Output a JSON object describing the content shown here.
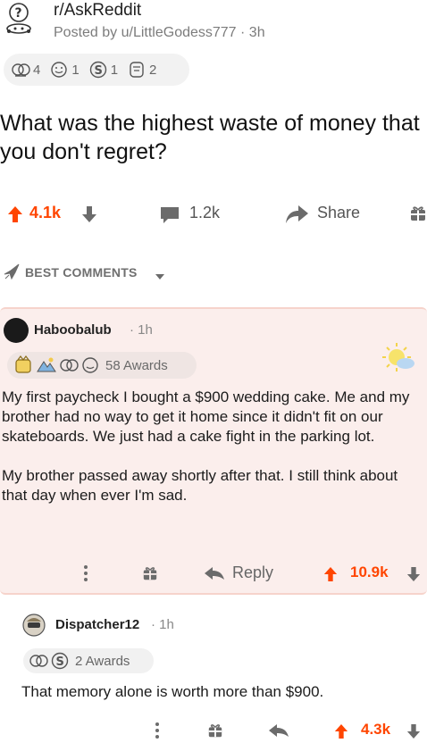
{
  "post": {
    "subreddit": "r/AskReddit",
    "posted_by": "Posted by u/LittleGodess777 · 3h",
    "awards": [
      {
        "icon": "helpful-award-icon",
        "count": "4"
      },
      {
        "icon": "wholesome-award-icon",
        "count": "1"
      },
      {
        "icon": "silver-award-icon",
        "count": "1"
      },
      {
        "icon": "facepalm-award-icon",
        "count": "2"
      }
    ],
    "title": "What was the highest waste of money that you don't regret?",
    "score": "4.1k",
    "comments": "1.2k",
    "share_label": "Share"
  },
  "sort": {
    "label": "BEST COMMENTS"
  },
  "top_comment": {
    "username": "Haboobalub",
    "time": "· 1h",
    "awards_label": "58 Awards",
    "paragraphs": [
      "My first paycheck I bought a $900 wedding cake. Me and my brother had no way to get it home since it didn't fit on our skateboards. We just had a cake fight in the parking lot.",
      "My brother passed away shortly after that. I still think about that day when ever I'm sad."
    ],
    "reply_label": "Reply",
    "score": "10.9k"
  },
  "reply_comment": {
    "username": "Dispatcher12",
    "time": "· 1h",
    "awards_label": "2 Awards",
    "body": "That memory alone is worth more than $900.",
    "score": "4.3k"
  },
  "colors": {
    "upvote": "#ff4500",
    "highlight_bg": "#fbeeec",
    "muted_text": "#7c7c7c"
  }
}
